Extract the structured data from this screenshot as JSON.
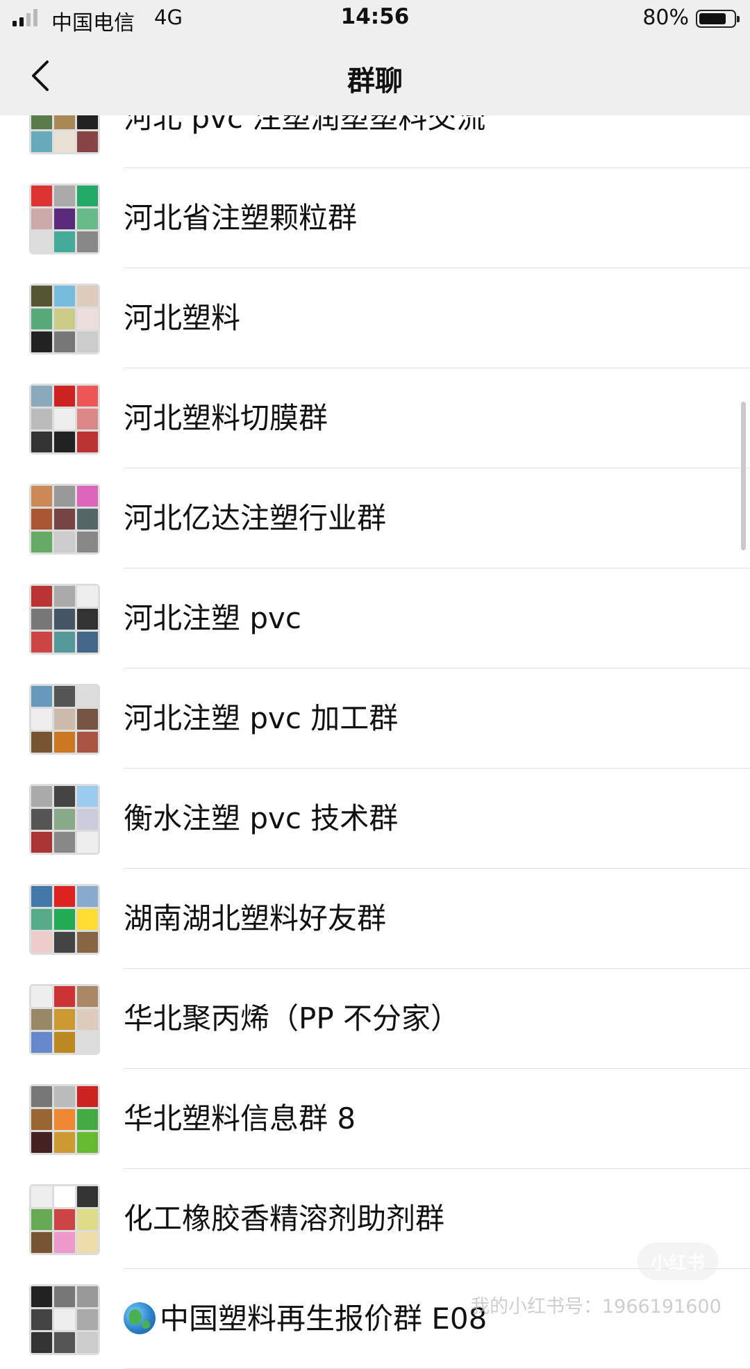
{
  "status_bar": {
    "carrier": "中国电信",
    "network": "4G",
    "time": "14:56",
    "battery_text": "80%",
    "battery_level": 0.8
  },
  "nav": {
    "title": "群聊",
    "back_icon": "chevron-left-icon"
  },
  "groups": [
    {
      "name": "河北 pvc 注塑润塑塑料交流",
      "colors": [
        "#3b5b8a",
        "#d7d7d7",
        "#c33",
        "#5a7c4a",
        "#aa8855",
        "#222",
        "#6ab",
        "#e9e2d4",
        "#844"
      ]
    },
    {
      "name": "河北省注塑颗粒群",
      "colors": [
        "#d33",
        "#aaa",
        "#2a6",
        "#caa",
        "#5a2b7a",
        "#6b8",
        "#ddd",
        "#4a9",
        "#888"
      ]
    },
    {
      "name": "河北塑料",
      "colors": [
        "#553",
        "#7bd",
        "#dcb",
        "#5a7",
        "#cc8",
        "#edd",
        "#222",
        "#777",
        "#ccc"
      ]
    },
    {
      "name": "河北塑料切膜群",
      "colors": [
        "#8ab",
        "#c22",
        "#e55",
        "#bbb",
        "#eee",
        "#d88",
        "#333",
        "#222",
        "#b33"
      ]
    },
    {
      "name": "河北亿达注塑行业群",
      "colors": [
        "#c85",
        "#999",
        "#d6b",
        "#a53",
        "#744",
        "#566",
        "#6a6",
        "#ccc",
        "#888"
      ]
    },
    {
      "name": "河北注塑 pvc",
      "colors": [
        "#b33",
        "#aaa",
        "#eee",
        "#777",
        "#456",
        "#333",
        "#c44",
        "#599",
        "#468"
      ]
    },
    {
      "name": "河北注塑 pvc 加工群",
      "colors": [
        "#69b",
        "#555",
        "#ddd",
        "#eee",
        "#cba",
        "#754",
        "#753",
        "#c72",
        "#a54"
      ]
    },
    {
      "name": "衡水注塑 pvc 技术群",
      "colors": [
        "#aaa",
        "#444",
        "#9ce",
        "#555",
        "#8a8",
        "#ccd",
        "#a33",
        "#888",
        "#eee"
      ]
    },
    {
      "name": "湖南湖北塑料好友群",
      "colors": [
        "#47a",
        "#d22",
        "#8ac",
        "#5a8",
        "#2a5",
        "#fd3",
        "#ecc",
        "#444",
        "#864"
      ]
    },
    {
      "name": "华北聚丙烯（PP 不分家）",
      "colors": [
        "#eee",
        "#c33",
        "#a86",
        "#986",
        "#c93",
        "#dcb",
        "#68c",
        "#b82",
        "#ddd"
      ]
    },
    {
      "name": "华北塑料信息群 8",
      "colors": [
        "#777",
        "#bbb",
        "#c22",
        "#963",
        "#e83",
        "#4a4",
        "#422",
        "#c93",
        "#6b3"
      ]
    },
    {
      "name": "化工橡胶香精溶剂助剂群",
      "colors": [
        "#eee",
        "#fff",
        "#333",
        "#6a5",
        "#c44",
        "#dd8",
        "#753",
        "#e9c",
        "#eda"
      ]
    },
    {
      "name": "中国塑料再生报价群 E08",
      "emoji": "globe-icon",
      "colors": [
        "#222",
        "#777",
        "#999",
        "#444",
        "#eee",
        "#aaa",
        "#333",
        "#555",
        "#ccc"
      ]
    }
  ],
  "watermark": {
    "badge": "小红书",
    "text": "我的小红书号：1966191600"
  }
}
